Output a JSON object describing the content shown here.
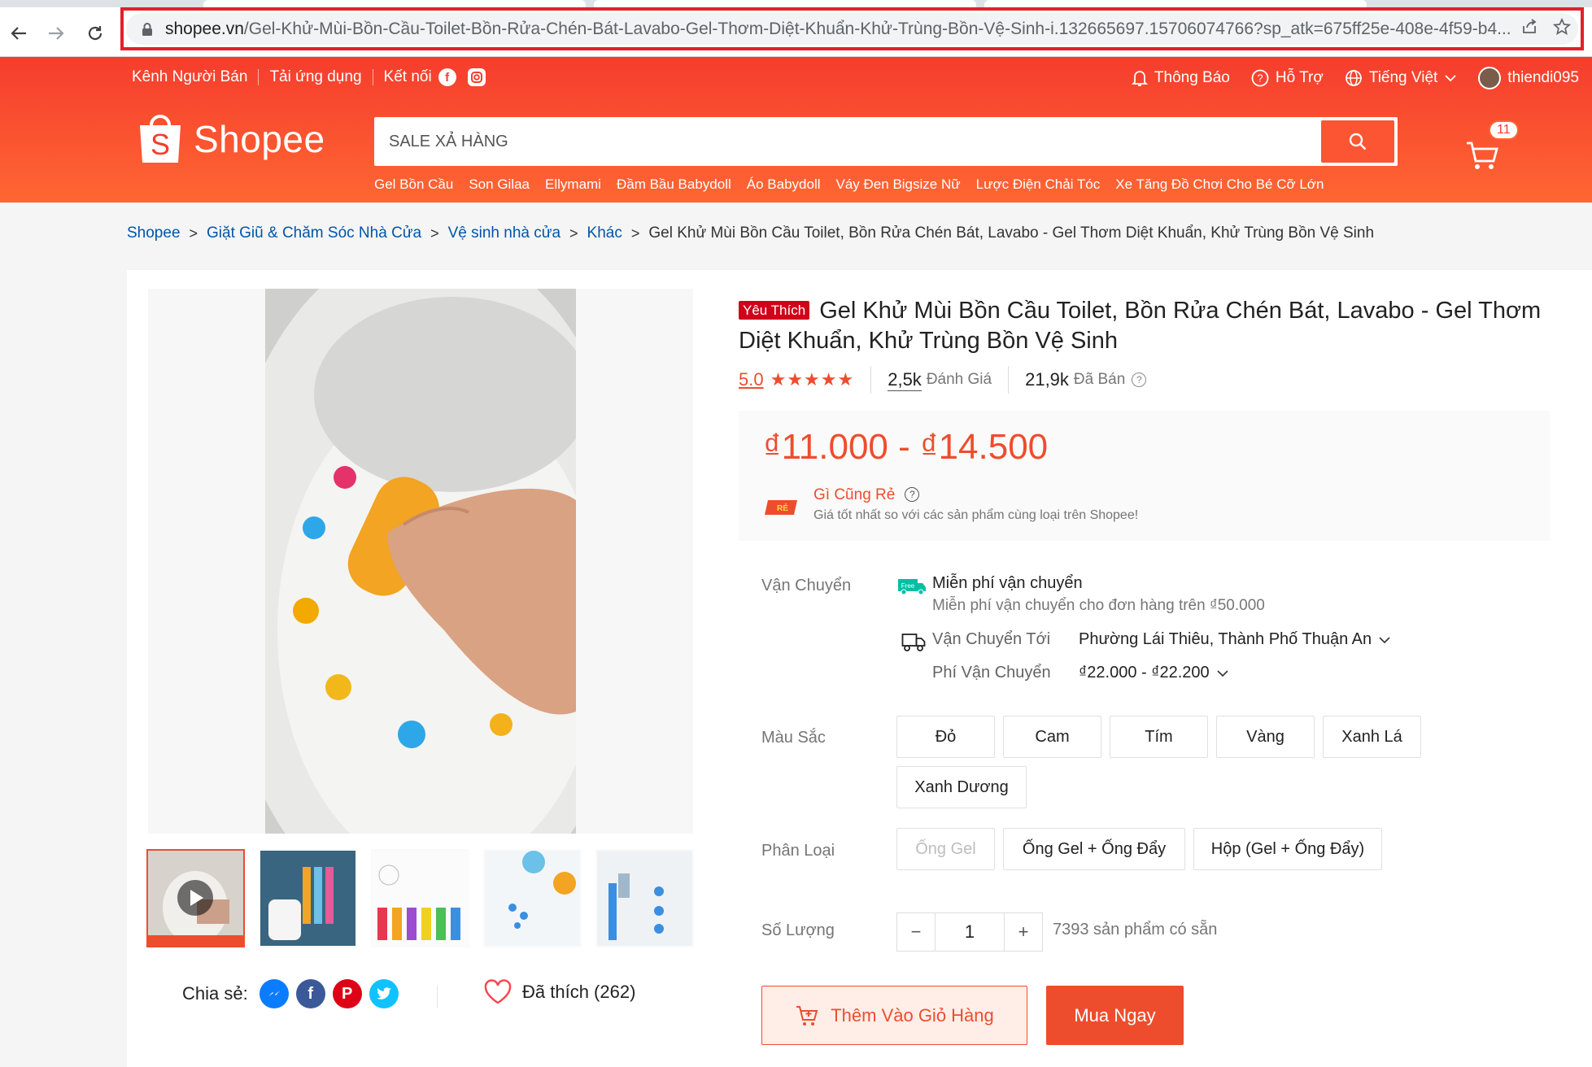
{
  "browser": {
    "url_host": "shopee.vn",
    "url_path": "/Gel-Khử-Mùi-Bồn-Cầu-Toilet-Bồn-Rửa-Chén-Bát-Lavabo-Gel-Thơm-Diệt-Khuẩn-Khử-Trùng-Bồn-Vệ-Sinh-i.132665697.15706074766?sp_atk=675ff25e-408e-4f59-b4..."
  },
  "header": {
    "seller_center": "Kênh Người Bán",
    "download_app": "Tải ứng dụng",
    "connect": "Kết nối",
    "notifications": "Thông Báo",
    "support": "Hỗ Trợ",
    "language": "Tiếng Việt",
    "username": "thiendi095",
    "logo_text": "Shopee",
    "search_placeholder": "SALE XẢ HÀNG",
    "cart_count": "11",
    "keywords": [
      "Gel Bồn Cầu",
      "Son Gilaa",
      "Ellymami",
      "Đầm Bầu Babydoll",
      "Áo Babydoll",
      "Váy Đen Bigsize Nữ",
      "Lược Điện Chải Tóc",
      "Xe Tăng Đồ Chơi Cho Bé Cỡ Lớn"
    ]
  },
  "breadcrumb": {
    "items": [
      "Shopee",
      "Giặt Giũ & Chăm Sóc Nhà Cửa",
      "Vệ sinh nhà cửa",
      "Khác"
    ],
    "current": "Gel Khử Mùi Bồn Cầu Toilet, Bồn Rửa Chén Bát, Lavabo - Gel Thơm Diệt Khuẩn, Khử Trùng Bồn Vệ Sinh"
  },
  "product": {
    "badge": "Yêu Thích",
    "title": "Gel Khử Mùi Bồn Cầu Toilet, Bồn Rửa Chén Bát, Lavabo - Gel Thơm Diệt Khuẩn, Khử Trùng Bồn Vệ Sinh",
    "rating": "5.0",
    "stars": "★★★★★",
    "reviews_count": "2,5k",
    "reviews_label": "Đánh Giá",
    "sold_count": "21,9k",
    "sold_label": "Đã Bán",
    "price": "₫11.000 - ₫14.500",
    "cheap_title": "Gì Cũng Rẻ",
    "cheap_badge": "RẺ",
    "cheap_sub": "Giá tốt nhất so với các sản phẩm cùng loại trên Shopee!",
    "free_label": "Free"
  },
  "shipping": {
    "label": "Vận Chuyển",
    "free_title": "Miễn phí vận chuyển",
    "free_sub": "Miễn phí vận chuyển cho đơn hàng trên ₫50.000",
    "to_label": "Vận Chuyển Tới",
    "to_value": "Phường Lái Thiêu, Thành Phố Thuận An",
    "fee_label": "Phí Vận Chuyển",
    "fee_value": "₫22.000 - ₫22.200"
  },
  "color": {
    "label": "Màu Sắc",
    "options": [
      "Đỏ",
      "Cam",
      "Tím",
      "Vàng",
      "Xanh Lá",
      "Xanh Dương"
    ]
  },
  "variant": {
    "label": "Phân Loại",
    "options": [
      "Ống Gel",
      "Ống Gel + Ống Đẩy",
      "Hộp (Gel + Ống Đẩy)"
    ]
  },
  "quantity": {
    "label": "Số Lượng",
    "value": "1",
    "minus": "−",
    "plus": "+",
    "stock": "7393 sản phẩm có sẵn"
  },
  "actions": {
    "add_to_cart": "Thêm Vào Giỏ Hàng",
    "buy_now": "Mua Ngay"
  },
  "social": {
    "share_label": "Chia sẻ:",
    "liked": "Đã thích (262)"
  },
  "colors": {
    "brand": "#ee4d2d",
    "header_top": "#f53d2d",
    "header_bottom": "#ff6633",
    "link": "#0055aa"
  }
}
